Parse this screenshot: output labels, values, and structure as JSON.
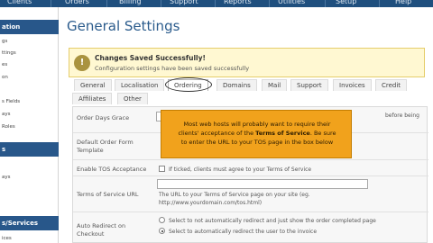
{
  "top_nav": {
    "items": [
      {
        "label": "Clients"
      },
      {
        "label": "Orders"
      },
      {
        "label": "Billing"
      },
      {
        "label": "Support"
      },
      {
        "label": "Reports"
      },
      {
        "label": "Utilities"
      },
      {
        "label": "Setup"
      },
      {
        "label": "Help"
      }
    ]
  },
  "sidebar": {
    "section1": {
      "title": "ation",
      "items": [
        "gs",
        "ttings",
        "es",
        "on",
        "s Fields",
        "ays",
        "Roles"
      ]
    },
    "section2": {
      "title": "s",
      "items": [
        "ays"
      ]
    },
    "section3": {
      "title": "s/Services",
      "items": [
        "ices"
      ]
    }
  },
  "page": {
    "title": "General Settings"
  },
  "success": {
    "title": "Changes Saved Successfully!",
    "text": "Configuration settings have been saved successfully"
  },
  "tabs": [
    {
      "label": "General"
    },
    {
      "label": "Localisation"
    },
    {
      "label": "Ordering",
      "active": true
    },
    {
      "label": "Domains"
    },
    {
      "label": "Mail"
    },
    {
      "label": "Support"
    },
    {
      "label": "Invoices"
    },
    {
      "label": "Credit"
    },
    {
      "label": "Affiliates"
    },
    {
      "label": "Other"
    }
  ],
  "form": {
    "order_days_grace": {
      "label": "Order Days Grace",
      "value_right": "before being"
    },
    "default_template": {
      "label1": "Default Order Form",
      "label2": "Template"
    },
    "enable_tos": {
      "label": "Enable TOS Acceptance",
      "text": "If ticked, clients must agree to your Terms of Service"
    },
    "tos_url": {
      "label": "Terms of Service URL",
      "help1": "The URL to your Terms of Service page on your site (eg.",
      "help2": "http://www.yourdomain.com/tos.html)"
    },
    "auto_redirect": {
      "label1": "Auto Redirect on",
      "label2": "Checkout",
      "option1": "Select to not automatically redirect and just show the order completed page",
      "option2": "Select to automatically redirect the user to the invoice"
    }
  },
  "tooltip": {
    "line1": "Most web hosts will probably want to require their",
    "line2_pre": "clients' acceptance of the ",
    "line2_bold": "Terms of Service",
    "line2_post": ". Be sure",
    "line3": "to enter the URL to your TOS page in the box below"
  },
  "colors": {
    "nav": "#1f4f7e",
    "title": "#2a5b8c",
    "success_bg": "#fff8d2",
    "tooltip": "#f1a21c"
  }
}
